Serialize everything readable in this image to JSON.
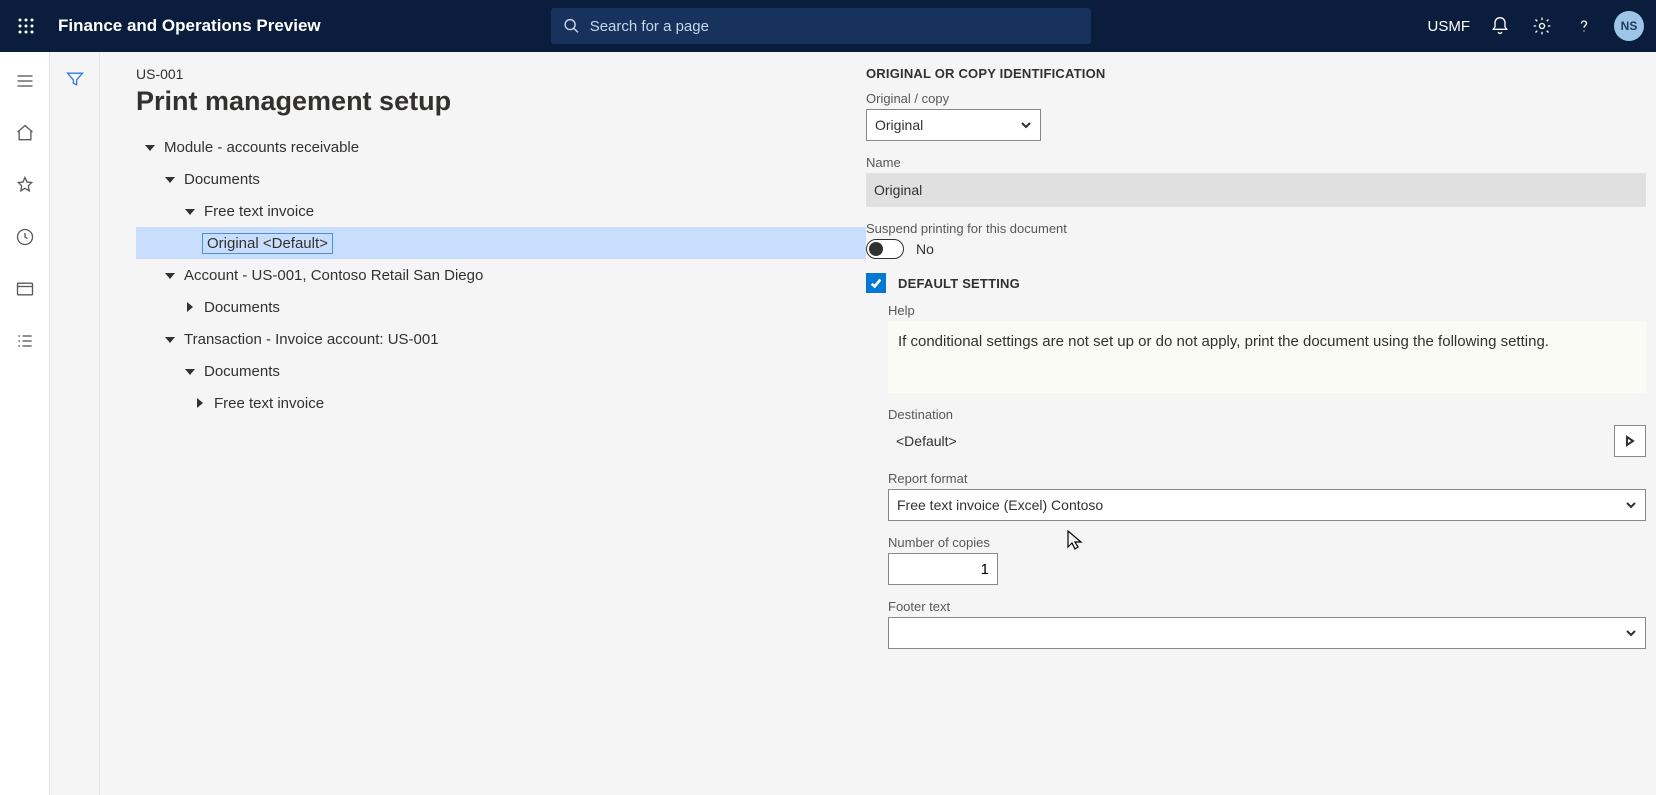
{
  "header": {
    "app_title": "Finance and Operations Preview",
    "search_placeholder": "Search for a page",
    "company": "USMF",
    "avatar_initials": "NS"
  },
  "page": {
    "breadcrumb": "US-001",
    "title": "Print management setup"
  },
  "tree": {
    "n0": "Module - accounts receivable",
    "n1": "Documents",
    "n2": "Free text invoice",
    "n3": "Original <Default>",
    "n4": "Account - US-001, Contoso Retail San Diego",
    "n5": "Documents",
    "n6": "Transaction - Invoice account: US-001",
    "n7": "Documents",
    "n8": "Free text invoice"
  },
  "form": {
    "section1": "ORIGINAL OR COPY IDENTIFICATION",
    "original_copy_label": "Original / copy",
    "original_copy_value": "Original",
    "name_label": "Name",
    "name_value": "Original",
    "suspend_label": "Suspend printing for this document",
    "suspend_value": "No",
    "default_setting_label": "DEFAULT SETTING",
    "help_label": "Help",
    "help_text": "If conditional settings are not set up or do not apply, print the document using the following setting.",
    "destination_label": "Destination",
    "destination_value": "<Default>",
    "report_format_label": "Report format",
    "report_format_value": "Free text invoice (Excel) Contoso",
    "copies_label": "Number of copies",
    "copies_value": "1",
    "footer_label": "Footer text",
    "footer_value": ""
  }
}
